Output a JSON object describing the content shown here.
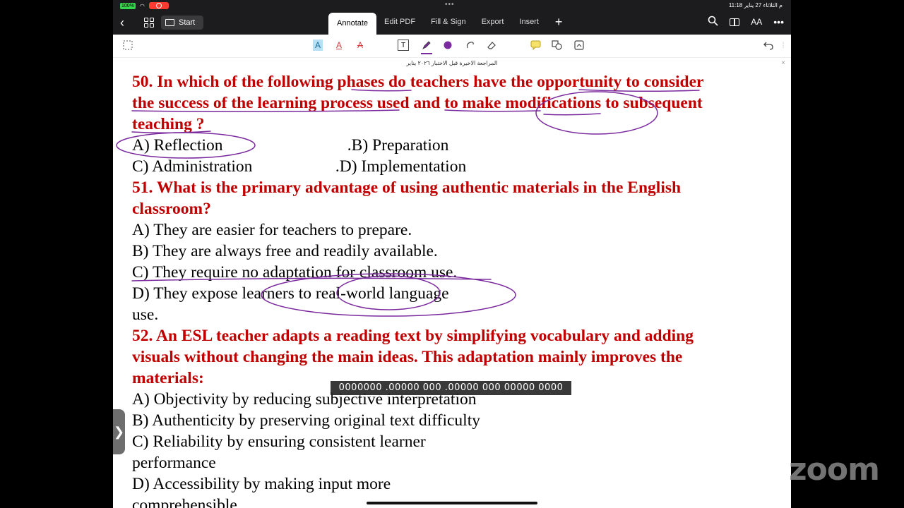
{
  "status_bar": {
    "battery": "100%",
    "time_date": "11:18 م  الثلاثاء 27 يناير"
  },
  "toolbar": {
    "back_icon": "chevron-left-icon",
    "grid_icon": "grid-icon",
    "start_label": "Start",
    "tabs": [
      "Annotate",
      "Edit PDF",
      "Fill & Sign",
      "Export",
      "Insert"
    ],
    "active_tab": "Annotate",
    "right_icons": [
      "search-icon",
      "book-icon",
      "text-size-icon",
      "more-icon"
    ],
    "text_size_label": "AA",
    "more_label": "•••"
  },
  "annotation_tools": {
    "tools": [
      "select",
      "highlight-text",
      "underline-text",
      "strikethrough-text",
      "text-box",
      "pen",
      "color",
      "lasso",
      "eraser",
      "comment",
      "shapes",
      "stamp",
      "undo"
    ],
    "text_tool_label": "T",
    "highlight_label": "A",
    "underline_label": "A",
    "strike_label": "A",
    "pen_color": "#7b2a9e"
  },
  "document": {
    "title": "المراجعة الاخيرة قبل الاختبار ٢٠٢٦ يناير",
    "lines": [
      {
        "text": "50. In which of the following phases do teachers have the opportunity to consider",
        "kind": "question"
      },
      {
        "text": "the success of the learning process used and to make modifications to subsequent",
        "kind": "question"
      },
      {
        "text": "teaching ?",
        "kind": "question"
      },
      {
        "text": "A) Reflection                              .B) Preparation",
        "kind": "option"
      },
      {
        "text": "C) Administration                    .D) Implementation",
        "kind": "option"
      },
      {
        "text": "51. What is the primary advantage of using authentic materials in the English",
        "kind": "question"
      },
      {
        "text": "classroom?",
        "kind": "question"
      },
      {
        "text": "A) They are easier for teachers to prepare.",
        "kind": "option"
      },
      {
        "text": "B) They are always free and readily available.",
        "kind": "option"
      },
      {
        "text": "C) They require no adaptation for classroom use.",
        "kind": "option"
      },
      {
        "text": "D) They expose learners to real-world language",
        "kind": "option"
      },
      {
        "text": "use.",
        "kind": "option"
      },
      {
        "text": "52. An ESL teacher adapts a reading text by simplifying vocabulary and adding",
        "kind": "question"
      },
      {
        "text": "visuals without changing the main ideas. This adaptation mainly improves the",
        "kind": "question"
      },
      {
        "text": "materials:",
        "kind": "question"
      },
      {
        "text": "A) Objectivity by reducing subjective interpretation",
        "kind": "option"
      },
      {
        "text": "B) Authenticity by preserving original text difficulty",
        "kind": "option"
      },
      {
        "text": "C) Reliability by ensuring consistent learner",
        "kind": "option"
      },
      {
        "text": "performance",
        "kind": "option"
      },
      {
        "text": "D) Accessibility by making input more",
        "kind": "option"
      },
      {
        "text": "comprehensible",
        "kind": "option"
      }
    ],
    "question_color": "#c00000",
    "ink_color": "#7b2a9e"
  },
  "caption": "0000000 .00000 000 .00000 000 00000 0000",
  "side_tab_icon": "chevron-right-icon",
  "side_tab_glyph": "❯",
  "zoom_watermark": "zoom"
}
